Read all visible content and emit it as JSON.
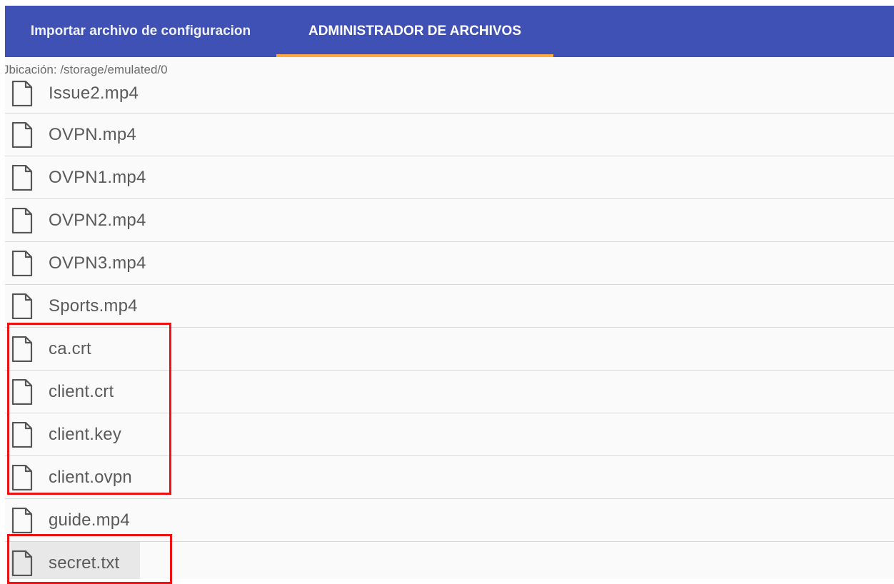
{
  "tabs": [
    {
      "label": "Importar archivo de configuracion",
      "active": false
    },
    {
      "label": "ADMINISTRADOR DE ARCHIVOS",
      "active": true
    }
  ],
  "location_label": "Jbicación: /storage/emulated/0",
  "files": [
    {
      "name": "Issue2.mp4"
    },
    {
      "name": "OVPN.mp4"
    },
    {
      "name": "OVPN1.mp4"
    },
    {
      "name": "OVPN2.mp4"
    },
    {
      "name": "OVPN3.mp4"
    },
    {
      "name": "Sports.mp4"
    },
    {
      "name": "ca.crt"
    },
    {
      "name": "client.crt"
    },
    {
      "name": "client.key"
    },
    {
      "name": "client.ovpn"
    },
    {
      "name": "guide.mp4"
    },
    {
      "name": "secret.txt"
    }
  ],
  "colors": {
    "tabbar": "#3f51b5",
    "indicator": "#ffab40",
    "highlight_box": "#ee1111",
    "text": "#5a5a5a"
  },
  "icons": {
    "file": "file-icon"
  }
}
